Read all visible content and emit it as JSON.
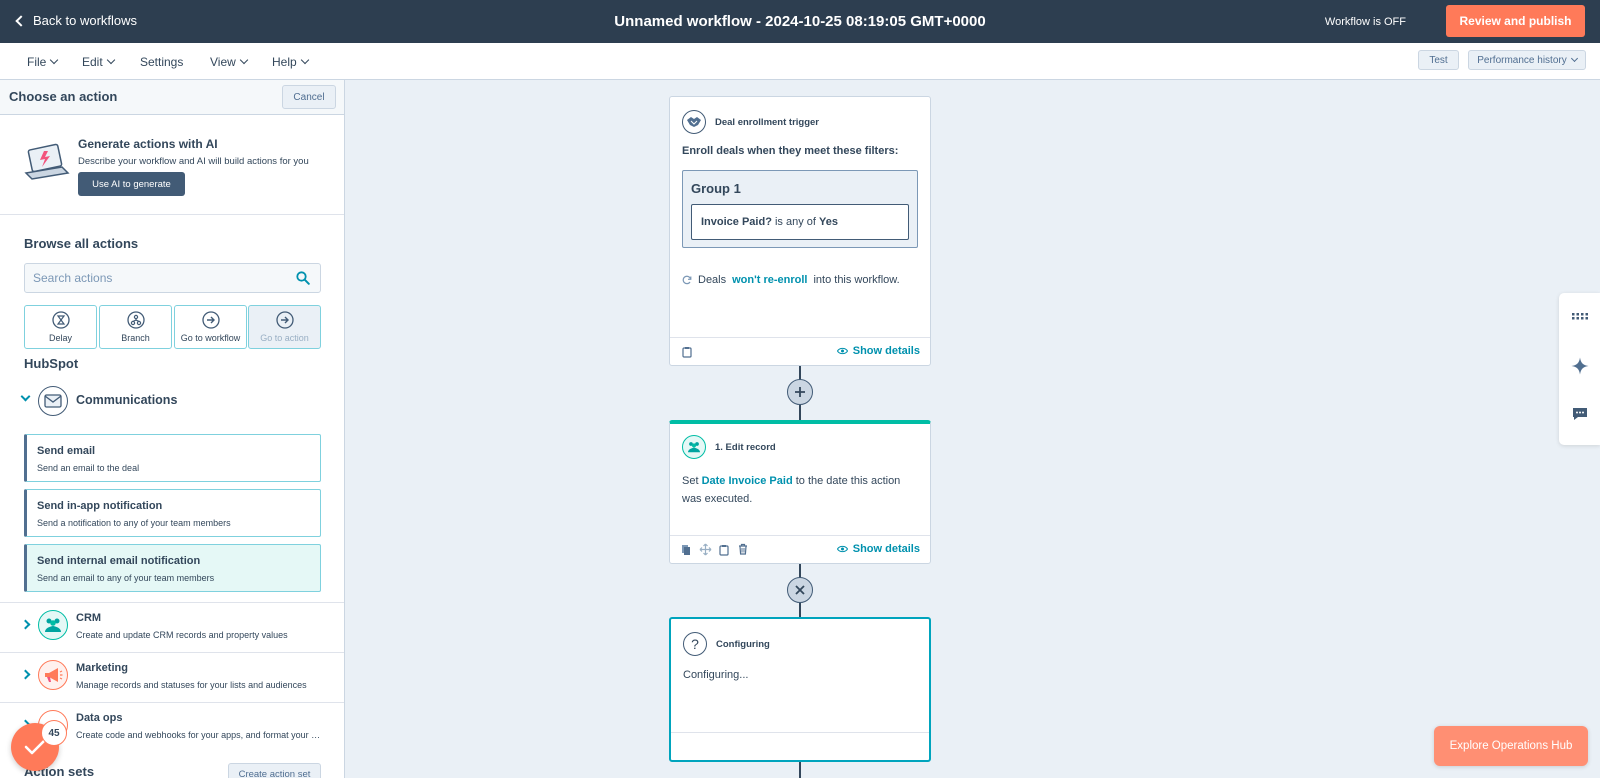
{
  "topbar": {
    "back_label": "Back to workflows",
    "title": "Unnamed workflow - 2024-10-25 08:19:05 GMT+0000",
    "status": "Workflow is OFF",
    "publish_label": "Review and publish"
  },
  "menubar": {
    "items": [
      "File",
      "Edit",
      "Settings",
      "View",
      "Help"
    ],
    "test_label": "Test",
    "history_label": "Performance history"
  },
  "panel": {
    "title": "Choose an action",
    "cancel_label": "Cancel",
    "ai": {
      "title": "Generate actions with AI",
      "desc": "Describe your workflow and AI will build actions for you",
      "button": "Use AI to generate"
    },
    "browse_title": "Browse all actions",
    "search_placeholder": "Search actions",
    "quick_actions": [
      "Delay",
      "Branch",
      "Go to workflow",
      "Go to action"
    ],
    "hubspot_label": "HubSpot",
    "communications": {
      "name": "Communications",
      "actions": [
        {
          "title": "Send email",
          "desc": "Send an email to the deal"
        },
        {
          "title": "Send in-app notification",
          "desc": "Send a notification to any of your team members"
        },
        {
          "title": "Send internal email notification",
          "desc": "Send an email to any of your team members"
        }
      ]
    },
    "categories": [
      {
        "name": "CRM",
        "desc": "Create and update CRM records and property values"
      },
      {
        "name": "Marketing",
        "desc": "Manage records and statuses for your lists and audiences"
      },
      {
        "name": "Data ops",
        "desc": "Create code and webhooks for your apps, and format your data"
      }
    ],
    "action_sets_label": "Action sets",
    "create_set_label": "Create action set",
    "fab_badge": "45"
  },
  "canvas": {
    "trigger": {
      "title": "Deal enrollment trigger",
      "subtitle": "Enroll deals when they meet these filters:",
      "group_label": "Group 1",
      "filter_property": "Invoice Paid?",
      "filter_op": "is any of",
      "filter_value": "Yes",
      "reenroll_prefix": "Deals",
      "reenroll_link": "won't re-enroll",
      "reenroll_suffix": "into this workflow.",
      "show_details": "Show details"
    },
    "edit_record": {
      "title": "1. Edit record",
      "text_prefix": "Set",
      "property": "Date Invoice Paid",
      "text_suffix": "to the date this action was executed.",
      "show_details": "Show details"
    },
    "configuring": {
      "title": "Configuring",
      "body": "Configuring..."
    }
  },
  "explore_label": "Explore Operations Hub",
  "colors": {
    "topbar": "#2d3e50",
    "accent": "#ff7a59",
    "teal": "#00bda5",
    "link": "#0091ae"
  }
}
